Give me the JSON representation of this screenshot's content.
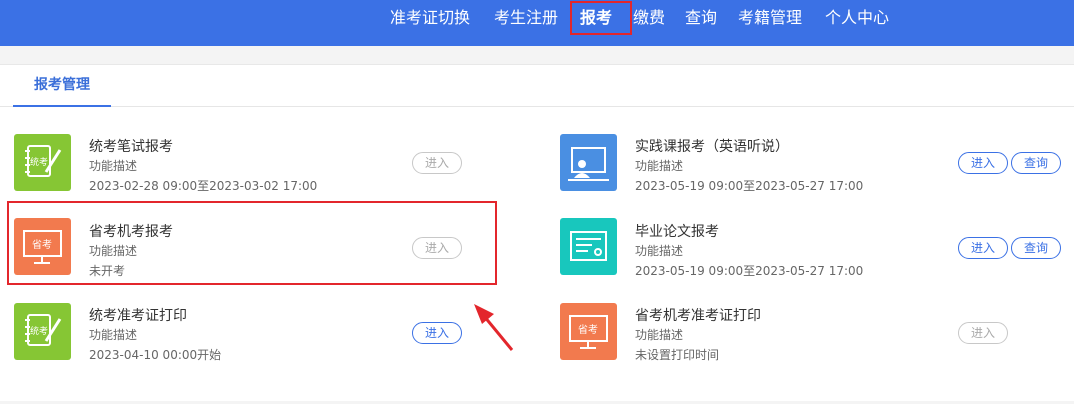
{
  "nav": {
    "items": [
      "准考证切换",
      "考生注册",
      "报考",
      "缴费",
      "查询",
      "考籍管理",
      "个人中心"
    ],
    "active": "报考"
  },
  "tab": {
    "label": "报考管理"
  },
  "cards": [
    {
      "title": "统考笔试报考",
      "desc": "功能描述",
      "info": "2023-02-28 09:00至2023-03-02 17:00",
      "icon": "exam-notebook-icon",
      "color": "#86c634",
      "buttons": [
        {
          "label": "进入",
          "enabled": false
        }
      ]
    },
    {
      "title": "实践课报考（英语听说）",
      "desc": "功能描述",
      "info": "2023-05-19 09:00至2023-05-27 17:00",
      "icon": "classroom-presenter-icon",
      "color": "#4a8fe2",
      "buttons": [
        {
          "label": "进入",
          "enabled": true
        },
        {
          "label": "查询",
          "enabled": true
        }
      ]
    },
    {
      "title": "省考机考报考",
      "desc": "功能描述",
      "info": "未开考",
      "icon": "computer-exam-icon",
      "color": "#f27a4e",
      "buttons": [
        {
          "label": "进入",
          "enabled": false
        }
      ]
    },
    {
      "title": "毕业论文报考",
      "desc": "功能描述",
      "info": "2023-05-19 09:00至2023-05-27 17:00",
      "icon": "certificate-document-icon",
      "color": "#18c7bd",
      "buttons": [
        {
          "label": "进入",
          "enabled": true
        },
        {
          "label": "查询",
          "enabled": true
        }
      ]
    },
    {
      "title": "统考准考证打印",
      "desc": "功能描述",
      "info": "2023-04-10 00:00开始",
      "icon": "exam-notebook-icon",
      "color": "#86c634",
      "buttons": [
        {
          "label": "进入",
          "enabled": true
        }
      ]
    },
    {
      "title": "省考机考准考证打印",
      "desc": "功能描述",
      "info": "未设置打印时间",
      "icon": "computer-exam-icon",
      "color": "#f27a4e",
      "buttons": [
        {
          "label": "进入",
          "enabled": false
        }
      ]
    }
  ],
  "icon_text": {
    "computer": "省考",
    "notebook": "统考"
  }
}
